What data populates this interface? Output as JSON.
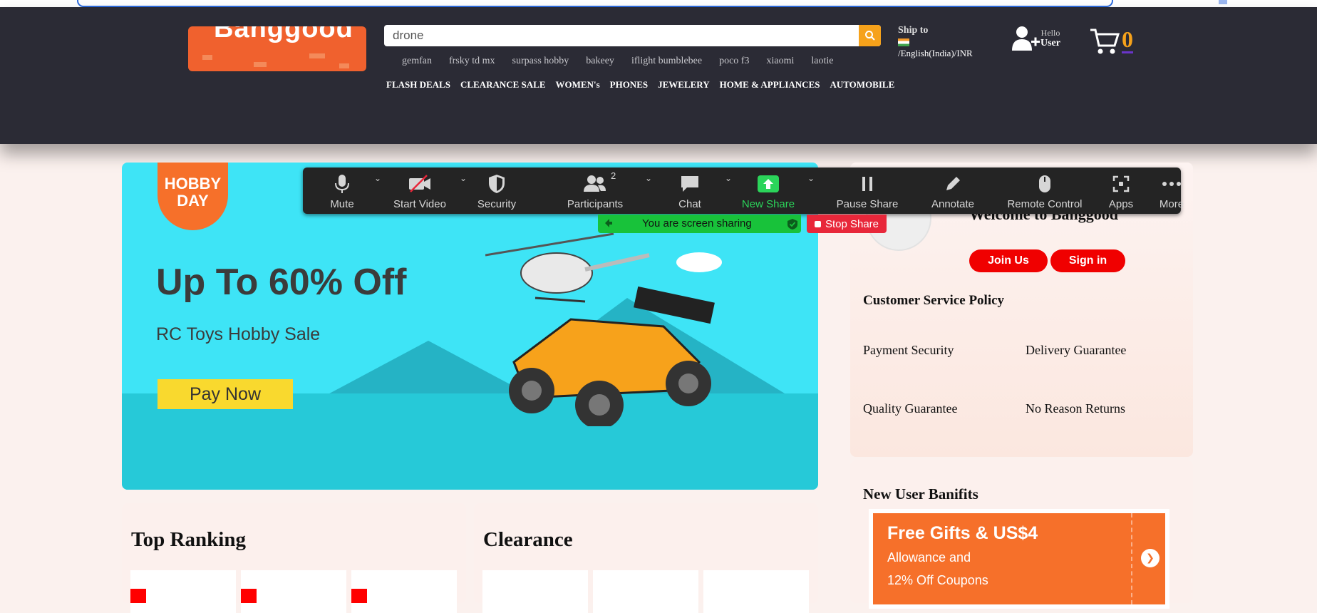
{
  "logo_text": "Banggood",
  "search": {
    "value": "drone"
  },
  "hot_words": [
    "gemfan",
    "frsky td mx",
    "surpass hobby",
    "bakeey",
    "iflight bumblebee",
    "poco f3",
    "xiaomi",
    "laotie"
  ],
  "categories": [
    "FLASH DEALS",
    "CLEARANCE SALE",
    "WOMEN's",
    "PHONES",
    "JEWELERY",
    "HOME & APPLIANCES",
    "AUTOMOBILE"
  ],
  "ship": {
    "label": "Ship to",
    "locale": "/English(India)/INR"
  },
  "user": {
    "hello": "Hello",
    "name": "User"
  },
  "cart": {
    "count": "0"
  },
  "banner": {
    "badge": "HOBBY DAY",
    "title": "Up To 60% Off",
    "subtitle": "RC Toys Hobby Sale",
    "button": "Pay Now"
  },
  "welcome": {
    "title": "Welcome to Banggood",
    "join": "Join Us",
    "signin": "Sign in"
  },
  "policy": {
    "title": "Customer Service Policy",
    "items": [
      "Payment Security",
      "Delivery Guarantee",
      "Quality Guarantee",
      "No Reason Returns"
    ]
  },
  "new_user": {
    "title": "New User Banifits",
    "line1": "Free Gifts & US$4",
    "line2": "Allowance and",
    "line3": "12% Off Coupons"
  },
  "sections": {
    "top_ranking": "Top Ranking",
    "clearance": "Clearance"
  },
  "zoom": {
    "participants_count": "2",
    "items": [
      "Mute",
      "Start Video",
      "Security",
      "Participants",
      "Chat",
      "New Share",
      "Pause Share",
      "Annotate",
      "Remote Control",
      "Apps",
      "More"
    ],
    "sharing_text": "You are screen sharing",
    "stop_share": "Stop Share",
    "accent_green": "#2bd45a",
    "stop_red": "#e8273a"
  },
  "colors": {
    "header_bg": "#2b2b35",
    "brand_orange": "#f0612e",
    "banner_cyan": "#3ee4f6",
    "button_red": "#f00000"
  }
}
